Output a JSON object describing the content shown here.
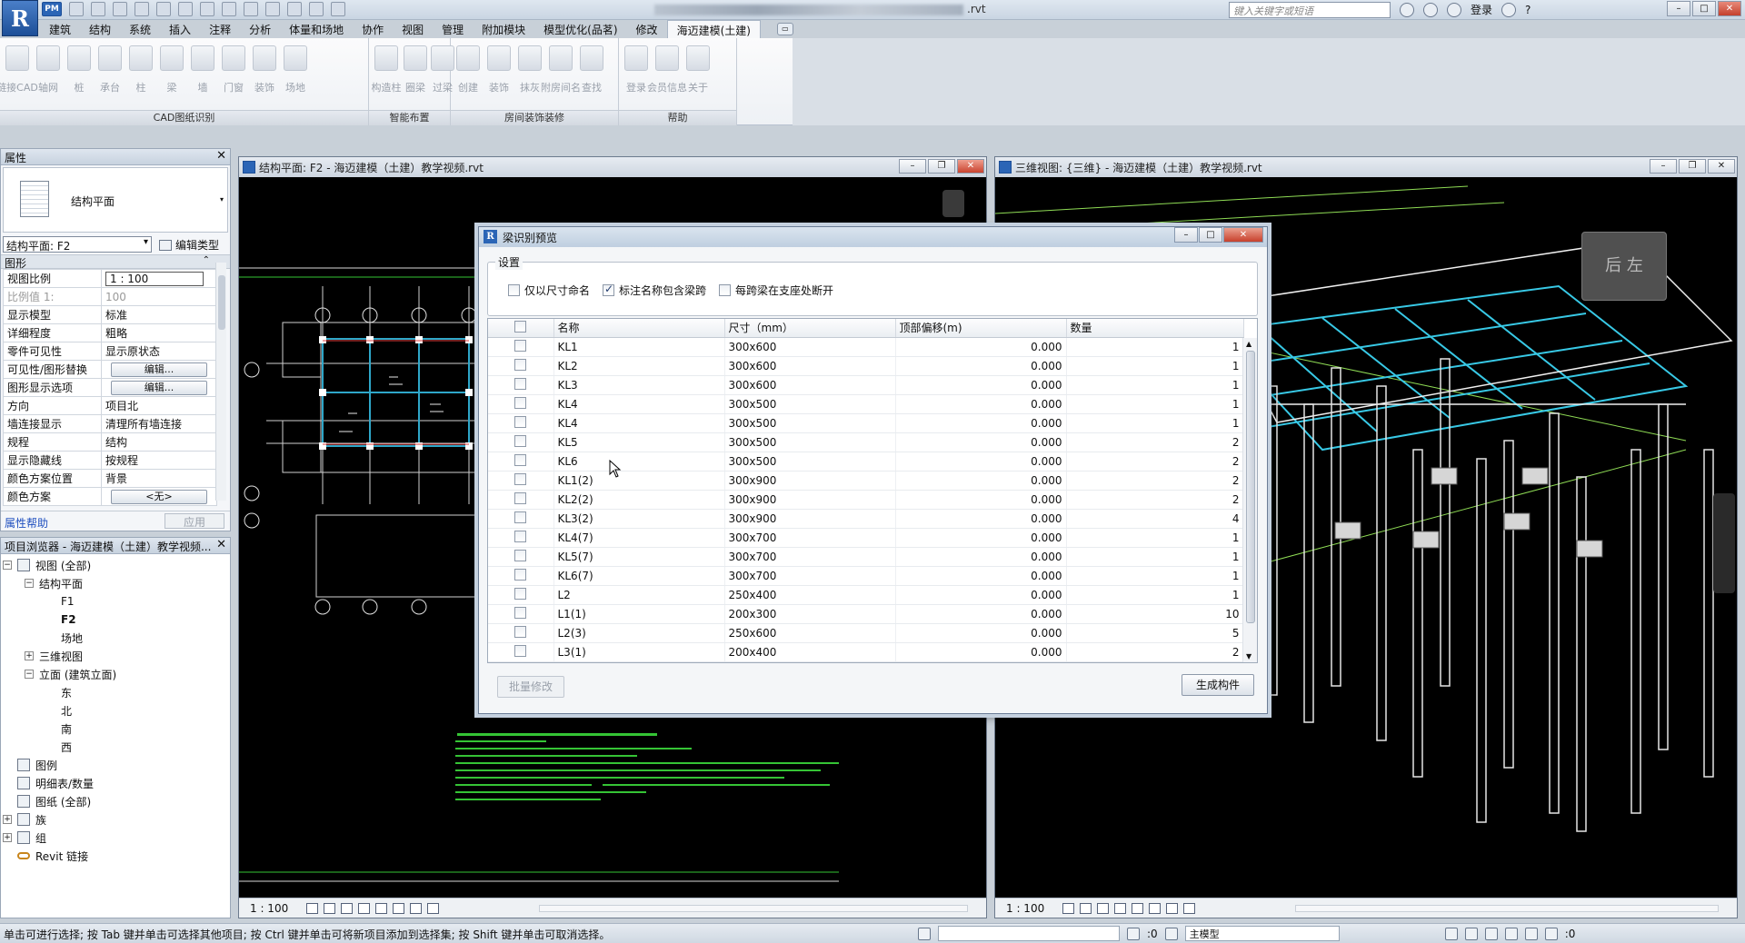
{
  "app": {
    "logo_letter": "R",
    "pm_label": "PM",
    "title_suffix": ".rvt",
    "search_placeholder": "键入关键字或短语",
    "login_label": "登录",
    "help_label": "?"
  },
  "tabs": [
    "建筑",
    "结构",
    "系统",
    "插入",
    "注释",
    "分析",
    "体量和场地",
    "协作",
    "视图",
    "管理",
    "附加模块",
    "模型优化(品茗)",
    "修改",
    "海迈建模(土建)"
  ],
  "ribbon": {
    "panels": [
      {
        "title": "CAD图纸识别",
        "tools": [
          "链接CAD",
          "轴网",
          "桩",
          "承台",
          "柱",
          "梁",
          "墙",
          "门窗",
          "装饰",
          "场地"
        ]
      },
      {
        "title": "智能布置",
        "tools": [
          "构造柱",
          "圈梁",
          "过梁"
        ]
      },
      {
        "title": "房间装饰装修",
        "tools": [
          "创建",
          "装饰",
          "抹灰",
          "附房间名",
          "查找"
        ]
      },
      {
        "title": "帮助",
        "tools": [
          "登录",
          "会员信息",
          "关于"
        ]
      }
    ]
  },
  "properties": {
    "header": "属性",
    "type_name": "结构平面",
    "instance": "结构平面: F2",
    "edit_type": "编辑类型",
    "group": "图形",
    "rows": [
      {
        "k": "视图比例",
        "v": "1 : 100",
        "kind": "input"
      },
      {
        "k": "比例值 1:",
        "v": "100",
        "kind": "muted"
      },
      {
        "k": "显示模型",
        "v": "标准",
        "kind": "text"
      },
      {
        "k": "详细程度",
        "v": "粗略",
        "kind": "text"
      },
      {
        "k": "零件可见性",
        "v": "显示原状态",
        "kind": "text"
      },
      {
        "k": "可见性/图形替换",
        "v": "编辑...",
        "kind": "button"
      },
      {
        "k": "图形显示选项",
        "v": "编辑...",
        "kind": "button"
      },
      {
        "k": "方向",
        "v": "项目北",
        "kind": "text"
      },
      {
        "k": "墙连接显示",
        "v": "清理所有墙连接",
        "kind": "text"
      },
      {
        "k": "规程",
        "v": "结构",
        "kind": "text"
      },
      {
        "k": "显示隐藏线",
        "v": "按规程",
        "kind": "text"
      },
      {
        "k": "颜色方案位置",
        "v": "背景",
        "kind": "text"
      },
      {
        "k": "颜色方案",
        "v": "<无>",
        "kind": "button"
      }
    ],
    "help_link": "属性帮助",
    "apply": "应用"
  },
  "browser": {
    "header": "项目浏览器 - 海迈建模（土建）教学视频...",
    "nodes": [
      {
        "t": "视图 (全部)",
        "lvl": 0,
        "pm": "−",
        "icon": true
      },
      {
        "t": "结构平面",
        "lvl": 1,
        "pm": "−"
      },
      {
        "t": "F1",
        "lvl": 2
      },
      {
        "t": "F2",
        "lvl": 2,
        "bold": true
      },
      {
        "t": "场地",
        "lvl": 2
      },
      {
        "t": "三维视图",
        "lvl": 1,
        "pm": "+"
      },
      {
        "t": "立面 (建筑立面)",
        "lvl": 1,
        "pm": "−"
      },
      {
        "t": "东",
        "lvl": 2
      },
      {
        "t": "北",
        "lvl": 2
      },
      {
        "t": "南",
        "lvl": 2
      },
      {
        "t": "西",
        "lvl": 2
      },
      {
        "t": "图例",
        "lvl": 0,
        "icon": true
      },
      {
        "t": "明细表/数量",
        "lvl": 0,
        "icon": true
      },
      {
        "t": "图纸 (全部)",
        "lvl": 0,
        "icon": true
      },
      {
        "t": "族",
        "lvl": 0,
        "pm": "+",
        "icon": true
      },
      {
        "t": "组",
        "lvl": 0,
        "pm": "+",
        "icon": true
      },
      {
        "t": "Revit 链接",
        "lvl": 0,
        "link": true
      }
    ]
  },
  "view_plan": {
    "title": "结构平面: F2 - 海迈建模（土建）教学视频.rvt",
    "scale": "1 : 100"
  },
  "view_3d": {
    "title": "三维视图: {三维} - 海迈建模（土建）教学视频.rvt",
    "scale": "1 : 100",
    "cube_label": "后 左"
  },
  "dialog": {
    "title": "梁识别预览",
    "settings_legend": "设置",
    "options": [
      {
        "label": "仅以尺寸命名",
        "checked": false
      },
      {
        "label": "标注名称包含梁跨",
        "checked": true
      },
      {
        "label": "每跨梁在支座处断开",
        "checked": false
      }
    ],
    "columns": [
      "名称",
      "尺寸（mm）",
      "顶部偏移(m)",
      "数量"
    ],
    "rows": [
      [
        "KL1",
        "300x600",
        "0.000",
        "1"
      ],
      [
        "KL2",
        "300x600",
        "0.000",
        "1"
      ],
      [
        "KL3",
        "300x600",
        "0.000",
        "1"
      ],
      [
        "KL4",
        "300x500",
        "0.000",
        "1"
      ],
      [
        "KL4",
        "300x500",
        "0.000",
        "1"
      ],
      [
        "KL5",
        "300x500",
        "0.000",
        "2"
      ],
      [
        "KL6",
        "300x500",
        "0.000",
        "2"
      ],
      [
        "KL1(2)",
        "300x900",
        "0.000",
        "2"
      ],
      [
        "KL2(2)",
        "300x900",
        "0.000",
        "2"
      ],
      [
        "KL3(2)",
        "300x900",
        "0.000",
        "4"
      ],
      [
        "KL4(7)",
        "300x700",
        "0.000",
        "1"
      ],
      [
        "KL5(7)",
        "300x700",
        "0.000",
        "1"
      ],
      [
        "KL6(7)",
        "300x700",
        "0.000",
        "1"
      ],
      [
        "L2",
        "250x400",
        "0.000",
        "1"
      ],
      [
        "L1(1)",
        "200x300",
        "0.000",
        "10"
      ],
      [
        "L2(3)",
        "250x600",
        "0.000",
        "5"
      ],
      [
        "L3(1)",
        "200x400",
        "0.000",
        "2"
      ]
    ],
    "batch_edit": "批量修改",
    "generate": "生成构件"
  },
  "status": {
    "hint": "单击可进行选择; 按 Tab 键并单击可选择其他项目; 按 Ctrl 键并单击可将新项目添加到选择集; 按 Shift 键并单击可取消选择。",
    "count": ":0",
    "model": "主模型",
    "filter_count": ":0"
  }
}
